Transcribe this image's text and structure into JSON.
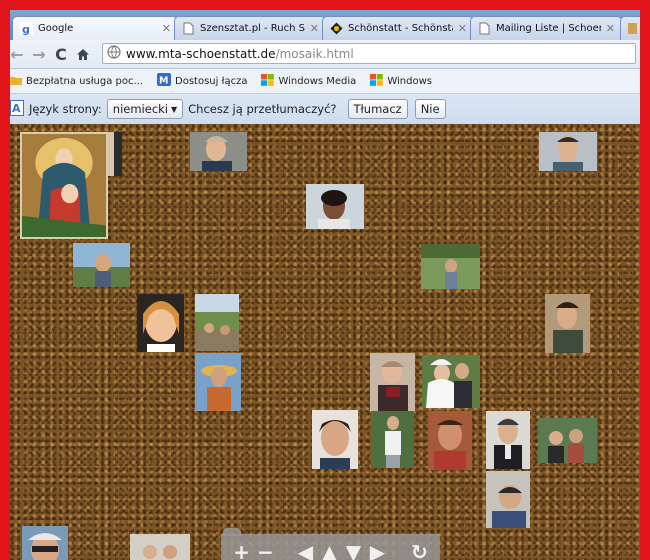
{
  "browser": {
    "tabs": [
      {
        "label": "Google",
        "icon": "google-favicon"
      },
      {
        "label": "Szensztat.pl - Ruch Sz...",
        "icon": "page-icon"
      },
      {
        "label": "Schönstatt - Schönstat...",
        "icon": "schoenstatt-favicon"
      },
      {
        "label": "Mailing Liste | Schoenst...",
        "icon": "page-icon"
      }
    ],
    "address": {
      "host": "www.mta-schoenstatt.de",
      "path": "/mosaik.html"
    },
    "bookmarks": [
      {
        "label": "Bezpłatna usługa poc...",
        "icon": "folder-icon"
      },
      {
        "label": "Dostosuj łącza",
        "icon": "msn-icon"
      },
      {
        "label": "Windows Media",
        "icon": "windows-icon"
      },
      {
        "label": "Windows",
        "icon": "windows-icon"
      }
    ],
    "translate_bar": {
      "language_label": "Język strony:",
      "language_selected": "niemiecki",
      "question": "Chcesz ją przetłumaczyć?",
      "translate_button": "Tłumacz",
      "no_button": "Nie"
    }
  },
  "mosaic": {
    "photo_count": 24,
    "controls": [
      "zoom-in",
      "zoom-out",
      "pan-left",
      "pan-up",
      "pan-down",
      "pan-right",
      "reset"
    ]
  },
  "colors": {
    "frame": "#e1141a",
    "accent_blue": "#5a86c4"
  }
}
